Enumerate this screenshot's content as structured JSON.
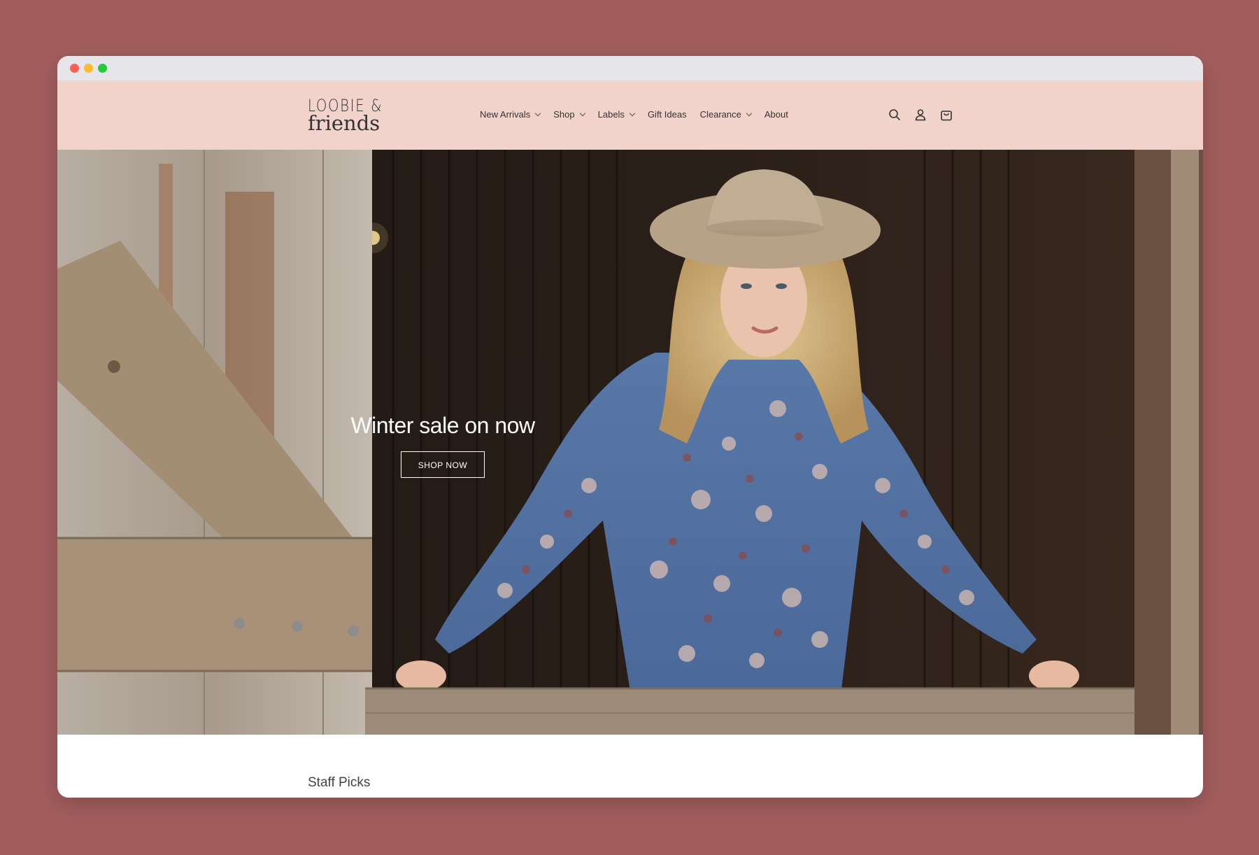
{
  "brand": {
    "line1": "LOOBIE &",
    "line2": "friends"
  },
  "nav": {
    "items": [
      {
        "label": "New Arrivals",
        "dropdown": true
      },
      {
        "label": "Shop",
        "dropdown": true
      },
      {
        "label": "Labels",
        "dropdown": true
      },
      {
        "label": "Gift Ideas",
        "dropdown": false
      },
      {
        "label": "Clearance",
        "dropdown": true
      },
      {
        "label": "About",
        "dropdown": false
      }
    ]
  },
  "header_icons": [
    "search-icon",
    "account-icon",
    "cart-icon"
  ],
  "hero": {
    "title": "Winter sale on now",
    "button_label": "SHOP NOW"
  },
  "section": {
    "title": "Staff Picks"
  },
  "colors": {
    "backdrop": "#a35d5d",
    "header_bg": "#f1d3cb",
    "titlebar": "#e6e5ea"
  }
}
